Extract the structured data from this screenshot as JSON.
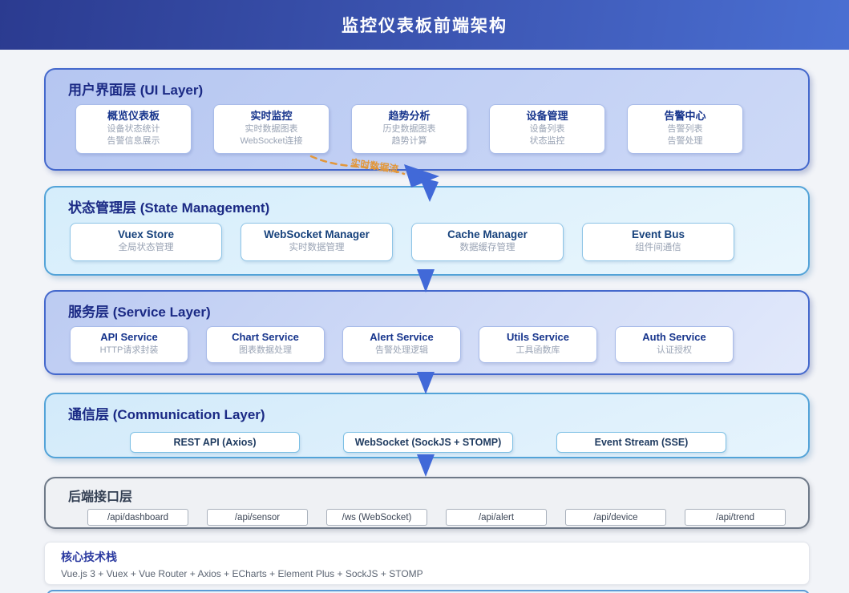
{
  "header": {
    "title": "监控仪表板前端架构"
  },
  "flow_label": "实时数据流",
  "layers": [
    {
      "id": "ui-layer",
      "title": "用户界面层 (UI Layer)",
      "cards": [
        {
          "title": "概览仪表板",
          "lines": [
            "设备状态统计",
            "告警信息展示"
          ]
        },
        {
          "title": "实时监控",
          "lines": [
            "实时数据图表",
            "WebSocket连接"
          ]
        },
        {
          "title": "趋势分析",
          "lines": [
            "历史数据图表",
            "趋势计算"
          ]
        },
        {
          "title": "设备管理",
          "lines": [
            "设备列表",
            "状态监控"
          ]
        },
        {
          "title": "告警中心",
          "lines": [
            "告警列表",
            "告警处理"
          ]
        }
      ]
    },
    {
      "id": "state-management-layer",
      "title": "状态管理层 (State Management)",
      "cards": [
        {
          "title": "Vuex Store",
          "lines": [
            "全局状态管理"
          ]
        },
        {
          "title": "WebSocket Manager",
          "lines": [
            "实时数据管理"
          ]
        },
        {
          "title": "Cache Manager",
          "lines": [
            "数据缓存管理"
          ]
        },
        {
          "title": "Event Bus",
          "lines": [
            "组件间通信"
          ]
        }
      ]
    },
    {
      "id": "service-layer",
      "title": "服务层 (Service Layer)",
      "cards": [
        {
          "title": "API Service",
          "lines": [
            "HTTP请求封装"
          ]
        },
        {
          "title": "Chart Service",
          "lines": [
            "图表数据处理"
          ]
        },
        {
          "title": "Alert Service",
          "lines": [
            "告警处理逻辑"
          ]
        },
        {
          "title": "Utils Service",
          "lines": [
            "工具函数库"
          ]
        },
        {
          "title": "Auth Service",
          "lines": [
            "认证授权"
          ]
        }
      ]
    },
    {
      "id": "communication-layer",
      "title": "通信层 (Communication Layer)",
      "cards": [
        {
          "title": "REST API (Axios)"
        },
        {
          "title": "WebSocket (SockJS + STOMP)"
        },
        {
          "title": "Event Stream (SSE)"
        }
      ]
    },
    {
      "id": "backend-api-layer",
      "title": "后端接口层",
      "cards": [
        {
          "title": "/api/dashboard"
        },
        {
          "title": "/api/sensor"
        },
        {
          "title": "/ws (WebSocket)"
        },
        {
          "title": "/api/alert"
        },
        {
          "title": "/api/device"
        },
        {
          "title": "/api/trend"
        }
      ]
    }
  ],
  "tech_stack": {
    "title": "核心技术栈",
    "items": "Vue.js 3 + Vuex + Vue Router + Axios + ECharts + Element Plus + SockJS + STOMP"
  },
  "colors": {
    "header_gradient_start": "#2b3b90",
    "header_gradient_end": "#4a6fd2",
    "ui_layer_border": "#4468cc",
    "state_layer_border": "#53a3d8",
    "backend_layer_border": "#6e7988",
    "arrow_blue": "#4169d8",
    "flow_orange": "#e2973b",
    "layer_title_navy": "#1b2a85",
    "card_title_navy": "#16348c",
    "card_subtitle_gray": "#99a3b4"
  }
}
